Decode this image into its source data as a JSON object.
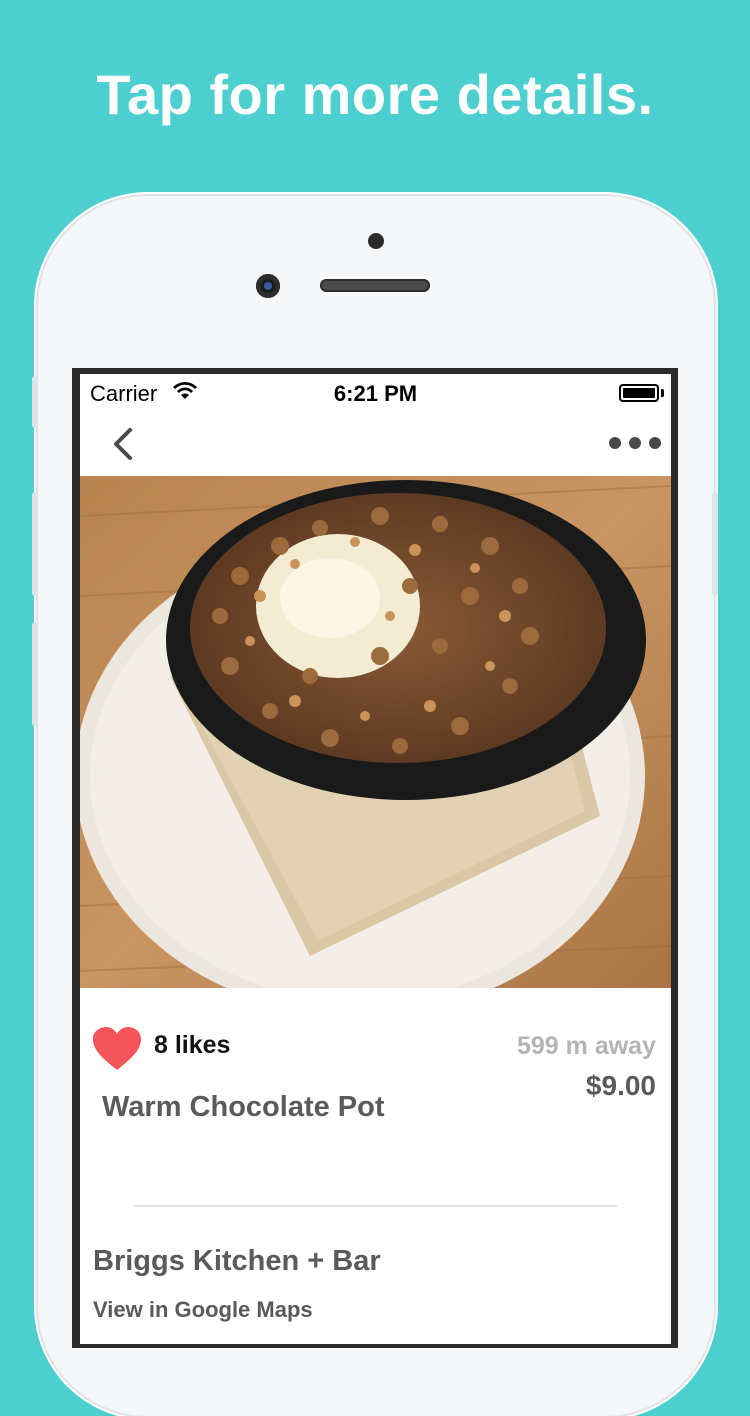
{
  "headline": "Tap for more details.",
  "status_bar": {
    "carrier": "Carrier",
    "time": "6:21 PM"
  },
  "nav": {
    "back_icon": "chevron-left-icon",
    "more_icon": "ellipsis-icon"
  },
  "photo": {
    "subject": "dish-photo"
  },
  "item": {
    "likes": "8 likes",
    "distance": "599 m away",
    "price": "$9.00",
    "name": "Warm Chocolate Pot"
  },
  "venue": {
    "name": "Briggs Kitchen + Bar",
    "maps_link": "View in Google Maps"
  },
  "colors": {
    "background": "#4ecfcf",
    "heart": "#f5555a",
    "text_primary": "#5a5a5a",
    "text_muted": "#b4b4b4"
  }
}
